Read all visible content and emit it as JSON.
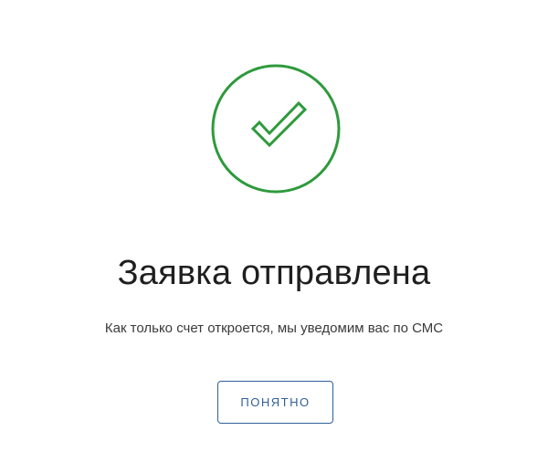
{
  "dialog": {
    "icon": "checkmark-circle-icon",
    "title": "Заявка отправлена",
    "message": "Как только счет откроется, мы уведомим вас по СМС",
    "confirm_label": "ПОНЯТНО"
  },
  "colors": {
    "success": "#2e9a3c",
    "accent": "#2f5f99",
    "text": "#1f1f1f"
  }
}
